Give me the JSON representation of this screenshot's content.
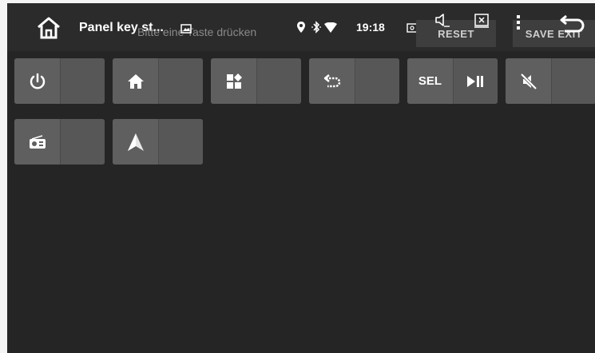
{
  "header": {
    "title": "Panel key st...",
    "hint": "Bitte eine Taste drücken",
    "clock": "19:18",
    "reset_label": "RESET",
    "save_exit_label": "SAVE EXIT"
  },
  "icons": {
    "home": "home-icon",
    "gallery": "image-icon",
    "location": "location-pin-icon",
    "bluetooth": "bluetooth-icon",
    "wifi": "wifi-icon",
    "screen": "screen-icon",
    "volume": "volume-icon",
    "close": "close-window-icon",
    "menu": "menu-dots-icon",
    "back": "back-icon"
  },
  "keys": [
    {
      "name": "power",
      "icon": "power-icon"
    },
    {
      "name": "home",
      "icon": "home-icon"
    },
    {
      "name": "apps",
      "icon": "apps-icon"
    },
    {
      "name": "back",
      "icon": "back-icon"
    },
    {
      "name": "select",
      "label": "SEL",
      "icon": "play-pause-icon"
    },
    {
      "name": "mute",
      "icon": "mute-icon"
    },
    {
      "name": "radio",
      "icon": "radio-icon"
    },
    {
      "name": "navigation",
      "icon": "navigation-icon"
    }
  ],
  "colors": {
    "background": "#252525",
    "key": "#585858",
    "text": "#ffffff",
    "hint": "#8a8a8a"
  }
}
